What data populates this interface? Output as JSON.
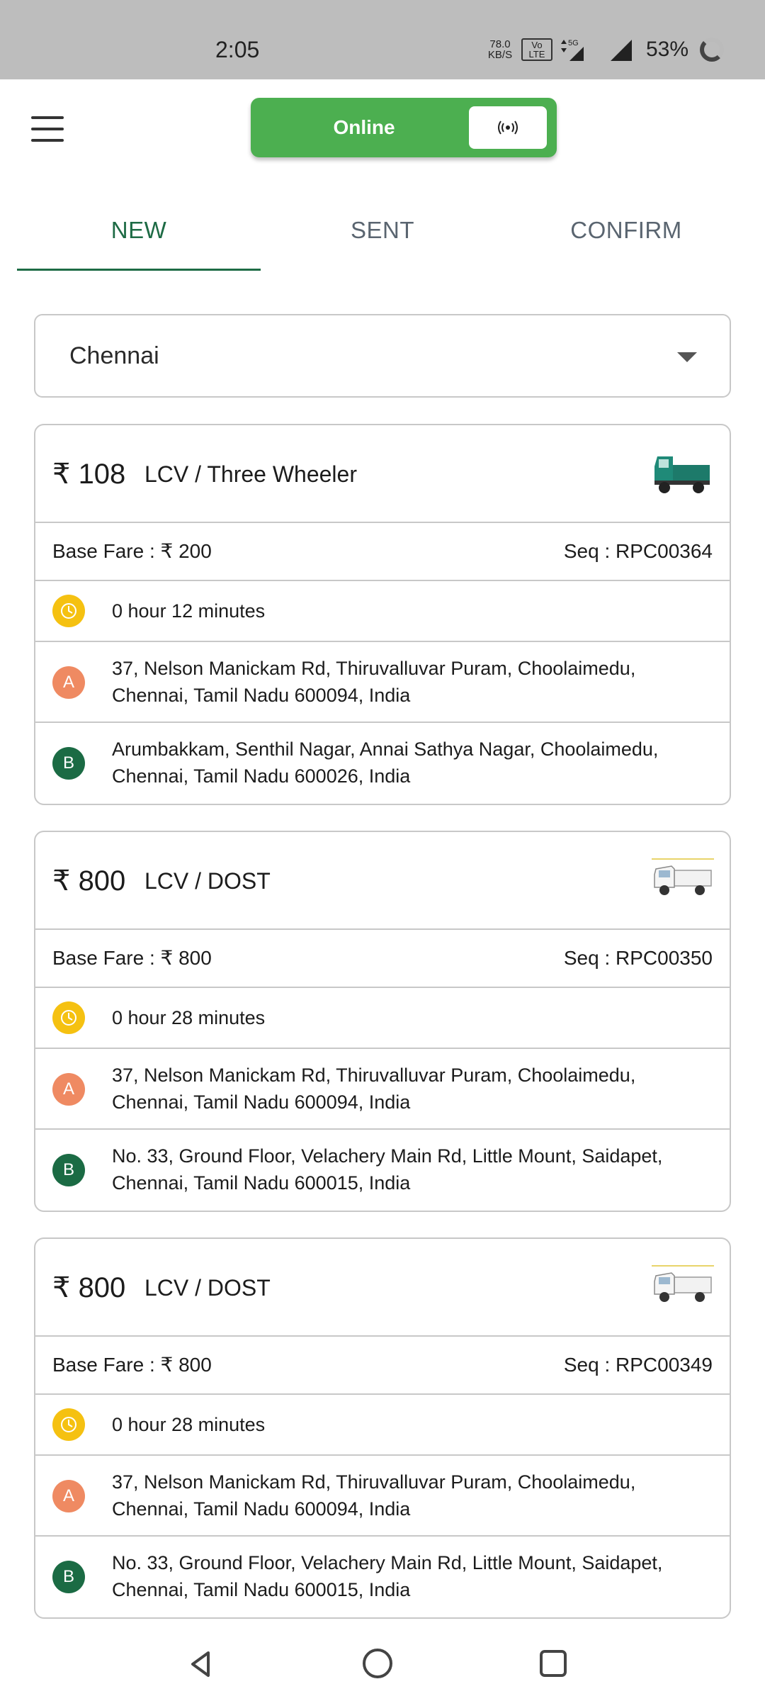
{
  "status_bar": {
    "time": "2:05",
    "speed_value": "78.0",
    "speed_unit": "KB/S",
    "volte": "Vo LTE",
    "network": "5G",
    "battery": "53%"
  },
  "header": {
    "menu_icon": "hamburger-menu-icon",
    "online_label": "Online",
    "toggle_icon": "broadcast-icon",
    "toggle_color": "#4caf50"
  },
  "tabs": [
    {
      "label": "NEW",
      "active": true
    },
    {
      "label": "SENT",
      "active": false
    },
    {
      "label": "CONFIRM",
      "active": false
    }
  ],
  "city_select": {
    "value": "Chennai"
  },
  "orders": [
    {
      "price": "₹ 108",
      "vehicle": "LCV / Three Wheeler",
      "base_fare": "Base Fare : ₹ 200",
      "seq": "Seq : RPC00364",
      "duration": "0 hour 12 minutes",
      "pickup_marker": "A",
      "pickup": "37, Nelson Manickam Rd, Thiruvalluvar Puram, Choolaimedu, Chennai, Tamil Nadu 600094, India",
      "drop_marker": "B",
      "drop": "Arumbakkam, Senthil Nagar, Annai Sathya Nagar, Choolaimedu, Chennai, Tamil Nadu 600026, India",
      "image": "three-wheeler-truck-icon"
    },
    {
      "price": "₹ 800",
      "vehicle": "LCV / DOST",
      "base_fare": "Base Fare : ₹ 800",
      "seq": "Seq : RPC00350",
      "duration": "0 hour 28 minutes",
      "pickup_marker": "A",
      "pickup": "37, Nelson Manickam Rd, Thiruvalluvar Puram, Choolaimedu, Chennai, Tamil Nadu 600094, India",
      "drop_marker": "B",
      "drop": "No. 33, Ground Floor, Velachery Main Rd, Little Mount, Saidapet, Chennai, Tamil Nadu 600015, India",
      "image": "pickup-truck-icon"
    },
    {
      "price": "₹ 800",
      "vehicle": "LCV / DOST",
      "base_fare": "Base Fare : ₹ 800",
      "seq": "Seq : RPC00349",
      "duration": "0 hour 28 minutes",
      "pickup_marker": "A",
      "pickup": "37, Nelson Manickam Rd, Thiruvalluvar Puram, Choolaimedu, Chennai, Tamil Nadu 600094, India",
      "drop_marker": "B",
      "drop": "No. 33, Ground Floor, Velachery Main Rd, Little Mount, Saidapet, Chennai, Tamil Nadu 600015, India",
      "image": "pickup-truck-icon"
    }
  ],
  "colors": {
    "accent_green": "#1e6b45",
    "toggle_green": "#4caf50",
    "clock_yellow": "#f5c111",
    "marker_a": "#ef8a62",
    "marker_b": "#1b6b44"
  }
}
